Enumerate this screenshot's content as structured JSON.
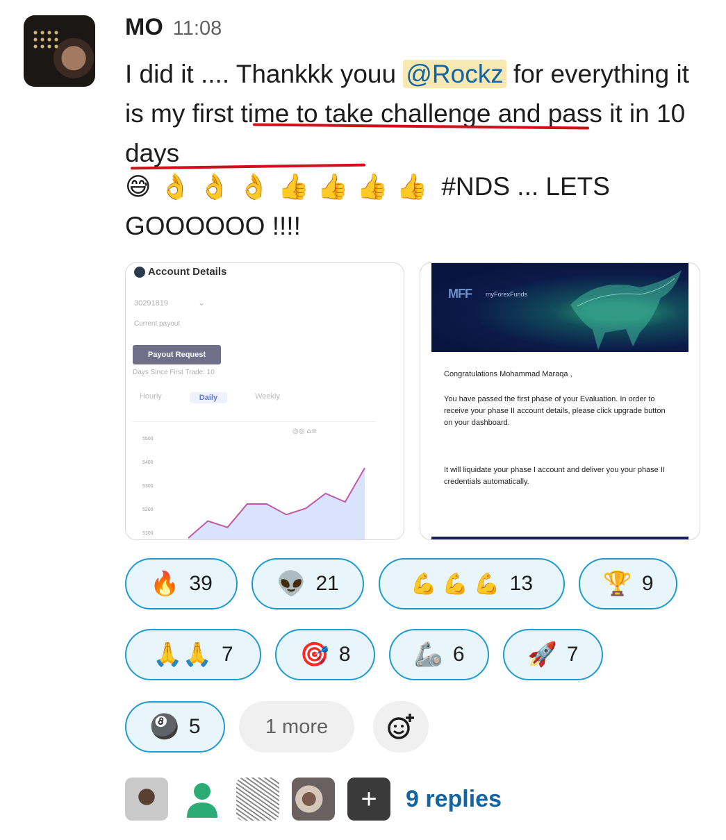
{
  "message": {
    "author": "MO",
    "time": "11:08",
    "text_parts": [
      "I did it .... Thankkk youu",
      "@Rockz",
      "for everything it is my first time to take challenge and pass it in 10 days"
    ],
    "emoji_line": [
      "😅",
      "👌",
      "👌",
      "👌",
      "👍",
      "👍",
      "👍",
      "👍"
    ],
    "tag_text": "#NDS ... LETS",
    "line2": "GOOOOOO !!!!"
  },
  "attachment_account": {
    "title": "Account Details",
    "account_number": "30291819",
    "current_payout": "Current payout",
    "payout_button": "Payout Request",
    "days_since": "Days Since First Trade: 10",
    "tabs": [
      "Hourly",
      "Daily",
      "Weekly"
    ],
    "active_tab": "Daily",
    "y_ticks": [
      "5500",
      "5400",
      "5300",
      "5200",
      "5100"
    ],
    "chart_data": {
      "type": "area",
      "values": [
        5090,
        5170,
        5140,
        5250,
        5250,
        5200,
        5230,
        5300,
        5260,
        5420
      ],
      "ylim": [
        5080,
        5440
      ]
    }
  },
  "attachment_email": {
    "logo": "MFF",
    "brand": "myForexFunds",
    "greeting": "Congratulations Mohammad Maraqa ,",
    "para1": "You have passed the first phase of your Evaluation. In order to receive your phase II account details, please click upgrade button on your dashboard.",
    "para2": "It will liquidate your phase I account and deliver you your phase II credentials automatically."
  },
  "reactions": [
    {
      "emoji": "🔥",
      "count": "39"
    },
    {
      "emoji": "👽",
      "count": "21"
    },
    {
      "emoji": "💪 💪 💪",
      "count": "13"
    },
    {
      "emoji": "🏆",
      "count": "9"
    },
    {
      "emoji": "🙏🙏",
      "count": "7"
    },
    {
      "emoji": "🎯",
      "count": "8"
    },
    {
      "emoji": "🦾",
      "count": "6"
    },
    {
      "emoji": "🚀",
      "count": "7"
    },
    {
      "emoji": "🎱",
      "count": "5"
    }
  ],
  "more_label": "1 more",
  "replies": {
    "plus": "+",
    "label": "9 replies"
  }
}
